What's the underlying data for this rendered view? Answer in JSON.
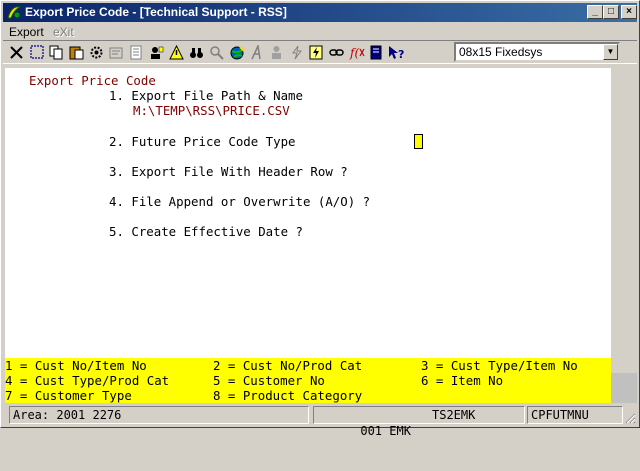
{
  "window": {
    "title": "Export Price Code - [Technical Support - RSS]",
    "minimize_label": "_",
    "maximize_label": "□",
    "close_label": "×"
  },
  "menu": {
    "items": [
      {
        "label": "Export",
        "enabled": true
      },
      {
        "label": "eXit",
        "enabled": false
      }
    ]
  },
  "toolbar": {
    "icons": [
      "close-x-icon",
      "select-icon",
      "copy-icon",
      "paste-icon",
      "settings-icon",
      "properties-icon",
      "list-icon",
      "user-icon",
      "alert-icon",
      "binoculars-icon",
      "zoom-icon",
      "globe-icon",
      "italic-a-icon",
      "person-icon",
      "lightning-icon",
      "lightning-doc-icon",
      "link-icon",
      "function-icon",
      "book-icon",
      "help-pointer-icon"
    ],
    "font_selector": {
      "value": "08x15 Fixedsys"
    }
  },
  "screen": {
    "heading": "Export Price Code",
    "options": [
      {
        "label": "1. Export File Path & Name",
        "value": "M:\\TEMP\\RSS\\PRICE.CSV"
      },
      {
        "label": "2. Future Price Code Type"
      },
      {
        "label": "3. Export File With Header Row ?"
      },
      {
        "label": "4. File Append or Overwrite (A/O) ?"
      },
      {
        "label": "5. Create Effective Date ?"
      }
    ],
    "legend": [
      [
        "1 = Cust No/Item No",
        "2 = Cust No/Prod Cat",
        "3 = Cust Type/Item No"
      ],
      [
        "4 = Cust Type/Prod Cat",
        "5 = Customer No",
        "6 = Item No"
      ],
      [
        "7 = Customer Type",
        "8 = Product Category",
        ""
      ]
    ]
  },
  "status": {
    "area": "Area: 2001 2276",
    "user": "001 EMK",
    "session": "TS2EMK",
    "program": "CPFUTMNU"
  }
}
